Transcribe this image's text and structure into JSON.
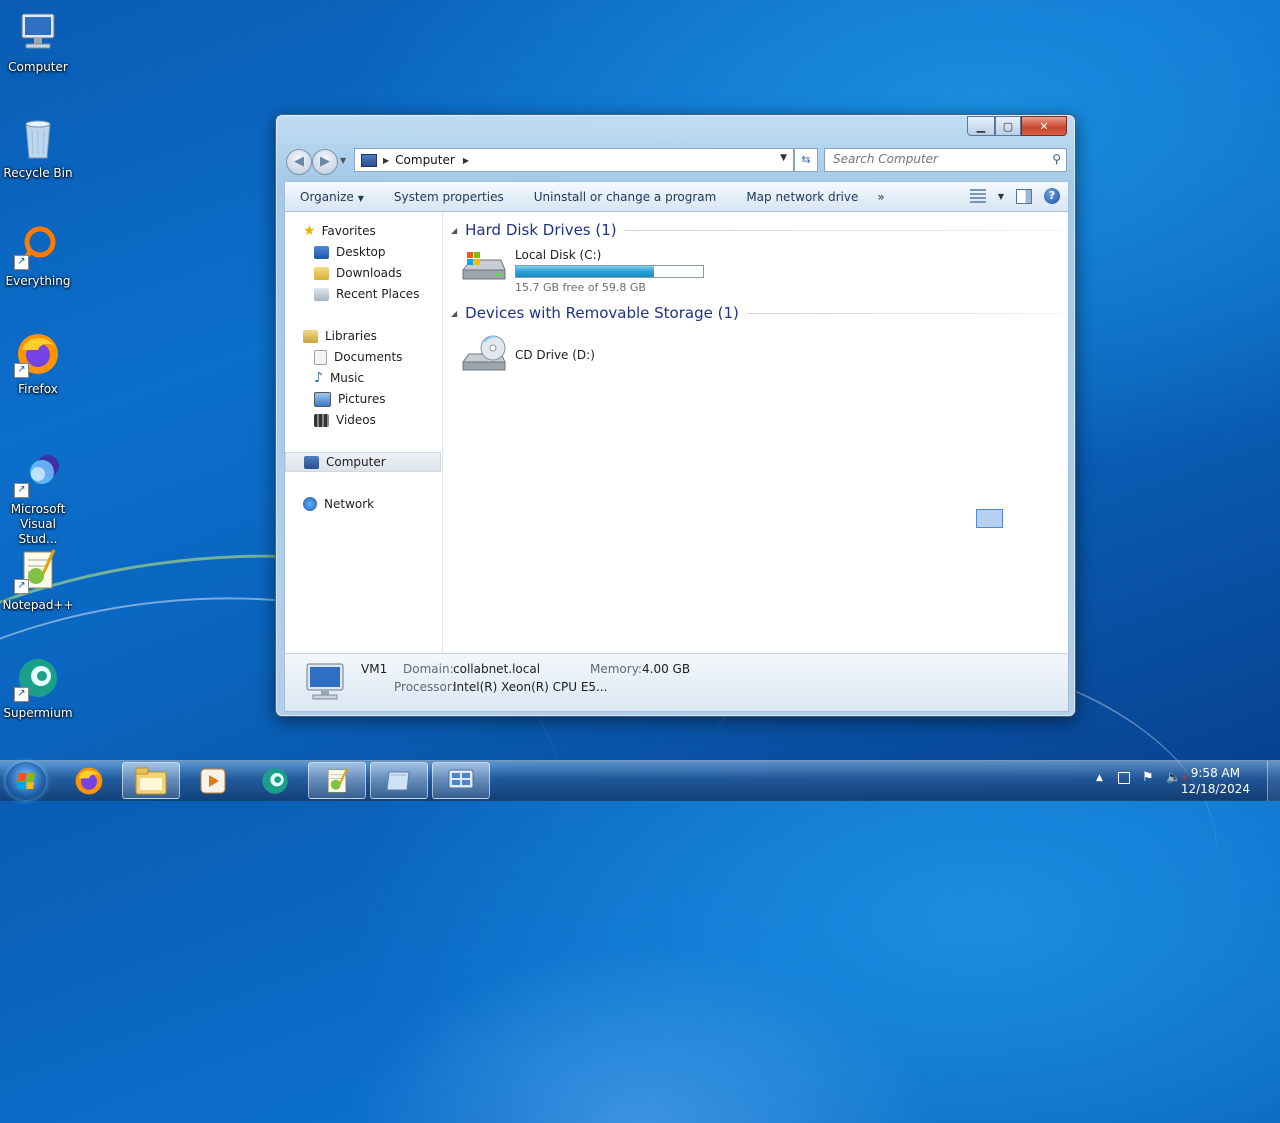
{
  "desktop": {
    "icons": [
      {
        "label": "Computer"
      },
      {
        "label": "Recycle Bin"
      },
      {
        "label": "Everything"
      },
      {
        "label": "Firefox"
      },
      {
        "label": "Microsoft Visual Stud..."
      },
      {
        "label": "Notepad++"
      },
      {
        "label": "Supermium"
      }
    ]
  },
  "window": {
    "buttons": {
      "minimize": "minimize-icon",
      "maximize": "maximize-icon",
      "close": "close-icon"
    },
    "address": {
      "crumb": "Computer"
    },
    "search": {
      "placeholder": "Search Computer"
    },
    "toolbar": {
      "organize": "Organize",
      "system_properties": "System properties",
      "uninstall": "Uninstall or change a program",
      "map_drive": "Map network drive",
      "more": "»"
    },
    "nav": {
      "favorites": "Favorites",
      "desktop": "Desktop",
      "downloads": "Downloads",
      "recent": "Recent Places",
      "libraries": "Libraries",
      "documents": "Documents",
      "music": "Music",
      "pictures": "Pictures",
      "videos": "Videos",
      "computer": "Computer",
      "network": "Network"
    },
    "groups": {
      "hdd_title": "Hard Disk Drives (1)",
      "removable_title": "Devices with Removable Storage (1)"
    },
    "drives": {
      "c": {
        "name": "Local Disk (C:)",
        "free": "15.7 GB free of 59.8 GB",
        "used_fraction": 0.737
      },
      "d": {
        "name": "CD Drive (D:)"
      }
    },
    "details": {
      "name": "VM1",
      "domain_label": "Domain:",
      "domain": "collabnet.local",
      "memory_label": "Memory:",
      "memory": "4.00 GB",
      "processor_label": "Processor:",
      "processor": "Intel(R) Xeon(R) CPU E5..."
    }
  },
  "taskbar": {
    "clock": {
      "time": "9:58 AM",
      "date": "12/18/2024"
    },
    "tray_arrow": "▲"
  },
  "colors": {
    "accent": "#1e3287",
    "link": "#1e395b",
    "progress": "#26a0da"
  }
}
